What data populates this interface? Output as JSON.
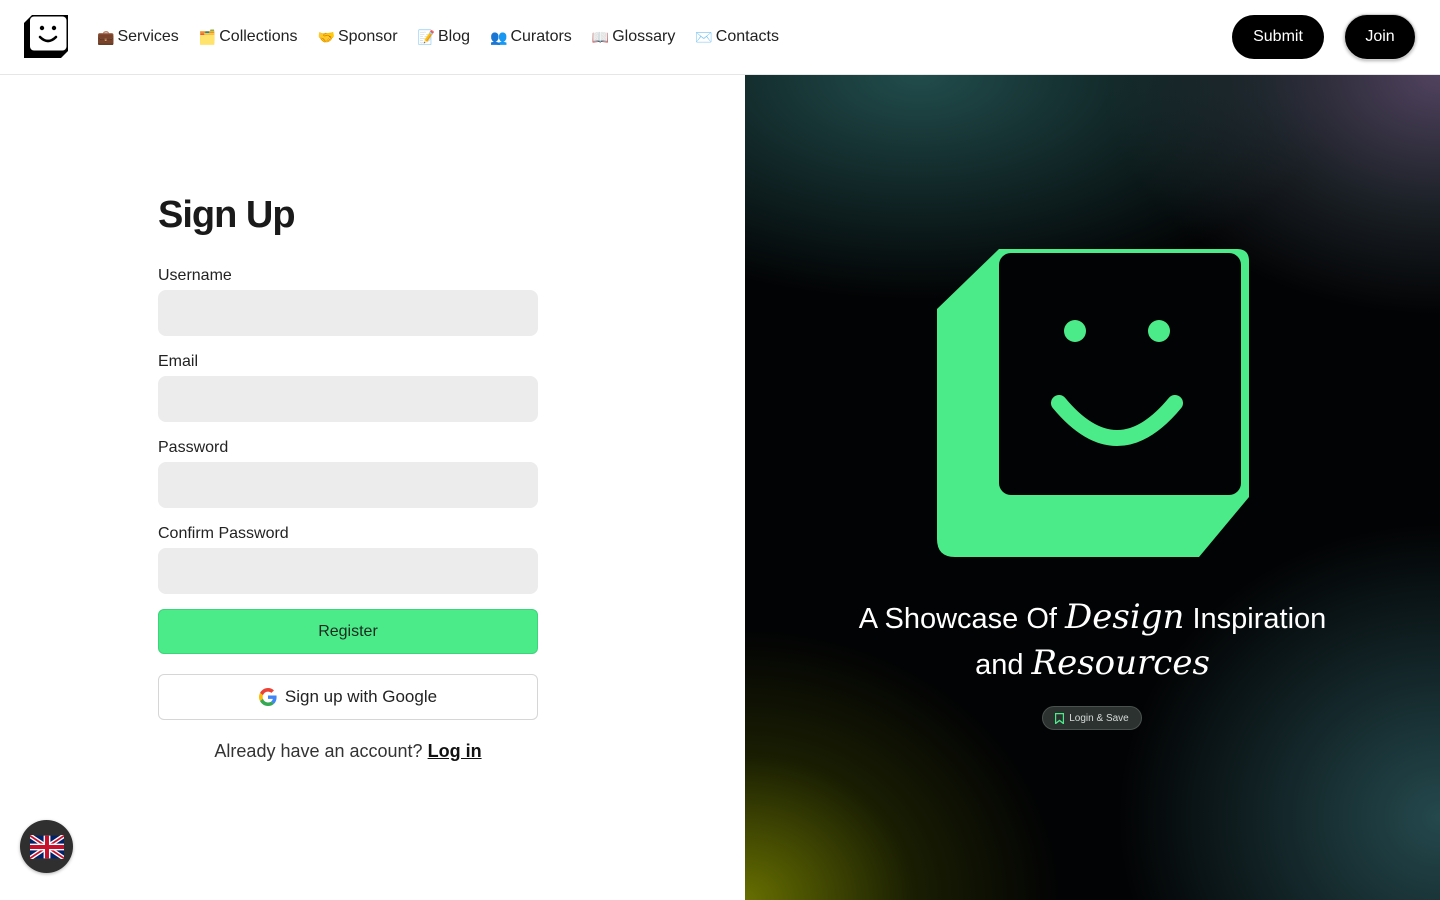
{
  "header": {
    "logo_icon": "smiley-box-logo",
    "nav": [
      {
        "emoji": "💼",
        "label": "Services"
      },
      {
        "emoji": "🗂️",
        "label": "Collections"
      },
      {
        "emoji": "🤝",
        "label": "Sponsor"
      },
      {
        "emoji": "📝",
        "label": "Blog"
      },
      {
        "emoji": "👥",
        "label": "Curators"
      },
      {
        "emoji": "📖",
        "label": "Glossary"
      },
      {
        "emoji": "✉️",
        "label": "Contacts"
      }
    ],
    "submit_label": "Submit",
    "join_label": "Join"
  },
  "form": {
    "title": "Sign Up",
    "username_label": "Username",
    "email_label": "Email",
    "password_label": "Password",
    "confirm_label": "Confirm Password",
    "register_label": "Register",
    "google_label": "Sign up with Google",
    "login_prompt": "Already have an account?",
    "login_link": "Log in"
  },
  "language": {
    "icon": "uk-flag-icon"
  },
  "hero": {
    "headline_part1": "A Showcase Of",
    "headline_italic1": "Design",
    "headline_part2": "Inspiration",
    "headline_part3": "and",
    "headline_italic2": "Resources",
    "pill_label": "Login & Save"
  },
  "colors": {
    "accent_green": "#4ceb8a",
    "button_black": "#000000",
    "input_bg": "#ececec"
  }
}
